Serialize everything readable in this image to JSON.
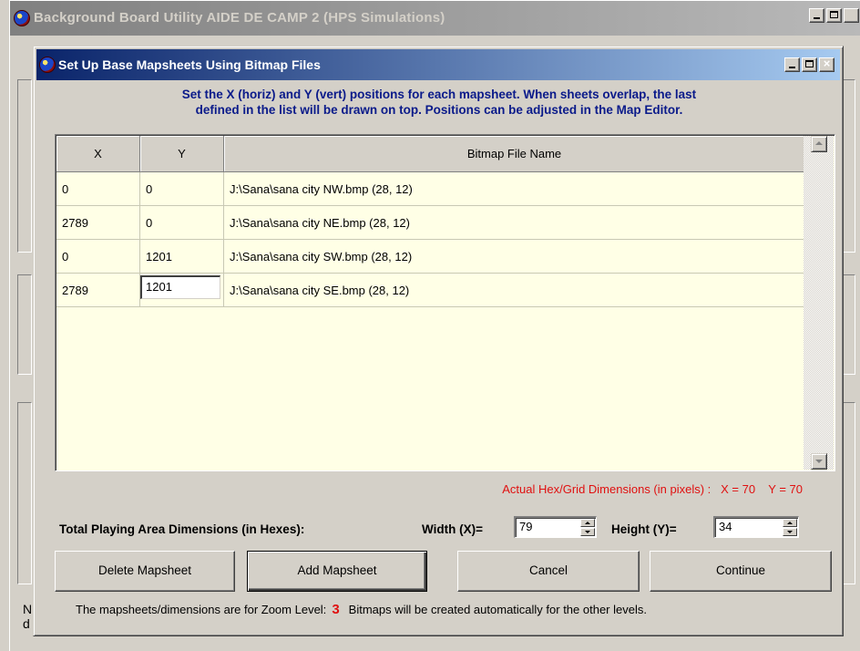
{
  "outer_window": {
    "title": "Background Board Utility  AIDE DE CAMP 2  (HPS Simulations)",
    "controls": [
      "_",
      "□",
      "×"
    ],
    "left_text_1": "N",
    "left_text_2": "d"
  },
  "dialog": {
    "title": "Set Up Base Mapsheets Using Bitmap Files",
    "instructions_line1": "Set the X (horiz) and Y (vert) positions for each mapsheet.  When sheets overlap, the last",
    "instructions_line2": "defined in the list will be drawn on top.  Positions can be adjusted in the Map Editor."
  },
  "table": {
    "headers": {
      "x": "X",
      "y": "Y",
      "file": "Bitmap File Name"
    },
    "rows": [
      {
        "x": "0",
        "y": "0",
        "file": "J:\\Sana\\sana city NW.bmp  (28, 12)"
      },
      {
        "x": "2789",
        "y": "0",
        "file": "J:\\Sana\\sana city NE.bmp  (28, 12)"
      },
      {
        "x": "0",
        "y": "1201",
        "file": "J:\\Sana\\sana city SW.bmp  (28, 12)"
      },
      {
        "x": "2789",
        "y": "1201",
        "file": "J:\\Sana\\sana city SE.bmp  (28, 12)"
      }
    ]
  },
  "actual_dims": "Actual Hex/Grid Dimensions (in pixels) :   X = 70    Y = 70",
  "playing_area": {
    "label": "Total Playing Area Dimensions (in Hexes):",
    "width_label": "Width (X)=",
    "width_value": "79",
    "height_label": "Height (Y)=",
    "height_value": "34"
  },
  "buttons": {
    "delete": "Delete Mapsheet",
    "add": "Add Mapsheet",
    "cancel": "Cancel",
    "continue": "Continue"
  },
  "footer": {
    "prefix": "The mapsheets/dimensions are for Zoom Level:",
    "zoom_level": "3",
    "suffix": "Bitmaps will be created automatically for the other levels."
  },
  "colors": {
    "title_active": "#0a246a",
    "title_inactive": "#808080",
    "instructions": "#0a1a8a",
    "accent_red": "#e01010",
    "grid_background": "#ffffe6"
  }
}
